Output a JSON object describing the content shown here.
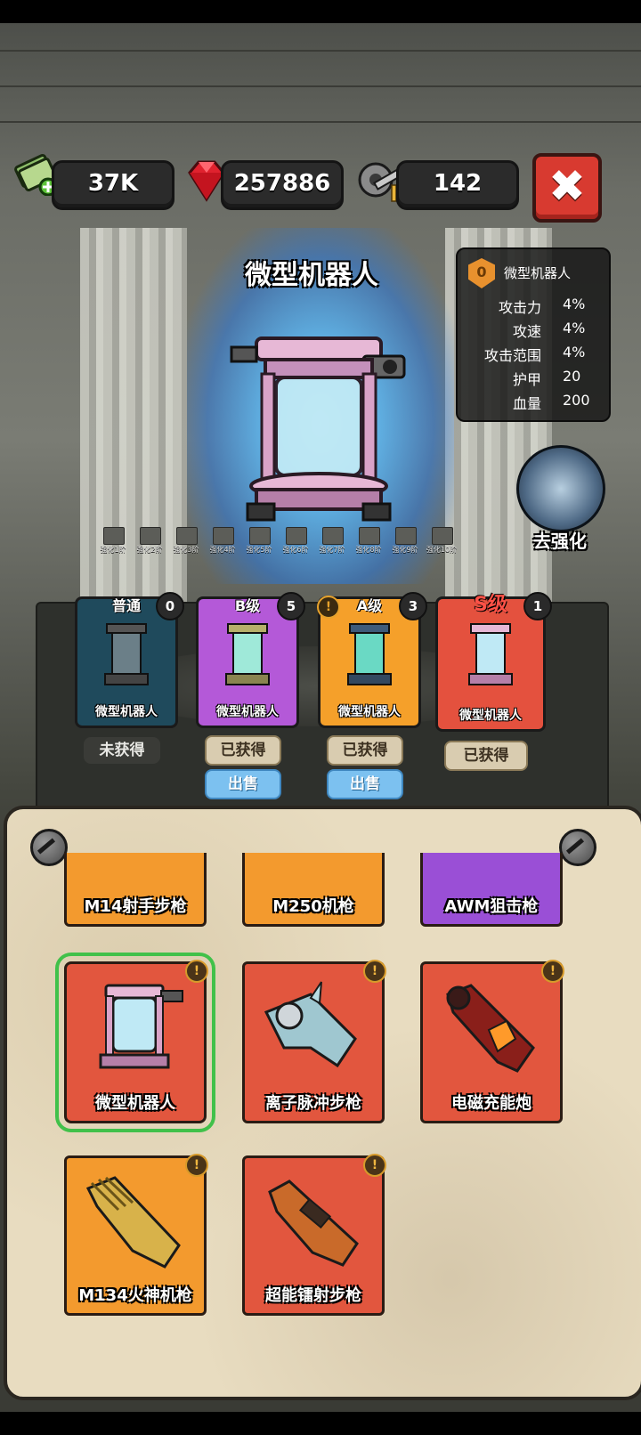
{
  "currency": {
    "cash": "37K",
    "gems": "257886",
    "parts": "142"
  },
  "close_label": "✖",
  "title": "微型机器人",
  "stats": {
    "level": "0",
    "name": "微型机器人",
    "rows": [
      {
        "k": "攻击力",
        "v": "4%"
      },
      {
        "k": "攻速",
        "v": "4%"
      },
      {
        "k": "攻击范围",
        "v": "4%"
      },
      {
        "k": "护甲",
        "v": "20"
      },
      {
        "k": "血量",
        "v": "200"
      }
    ]
  },
  "stages": [
    "强化1阶",
    "强化2阶",
    "强化3阶",
    "强化4阶",
    "强化5阶",
    "强化6阶",
    "强化7阶",
    "强化8阶",
    "强化9阶",
    "强化10阶"
  ],
  "go_enhance": "去强化",
  "grades": [
    {
      "tag": "普通",
      "count": "0",
      "name": "微型机器人",
      "status": "未获得",
      "sell": ""
    },
    {
      "tag": "B级",
      "count": "5",
      "name": "微型机器人",
      "status": "已获得",
      "sell": "出售"
    },
    {
      "tag": "A级",
      "count": "3",
      "name": "微型机器人",
      "status": "已获得",
      "sell": "出售"
    },
    {
      "tag": "S级",
      "count": "1",
      "name": "微型机器人",
      "status": "已获得",
      "sell": ""
    }
  ],
  "weapons": [
    {
      "name": "M14射手步枪"
    },
    {
      "name": "M250机枪"
    },
    {
      "name": "AWM狙击枪"
    },
    {
      "name": "微型机器人"
    },
    {
      "name": "离子脉冲步枪"
    },
    {
      "name": "电磁充能炮"
    },
    {
      "name": "M134火神机枪"
    },
    {
      "name": "超能镭射步枪"
    }
  ],
  "alert_glyph": "!"
}
